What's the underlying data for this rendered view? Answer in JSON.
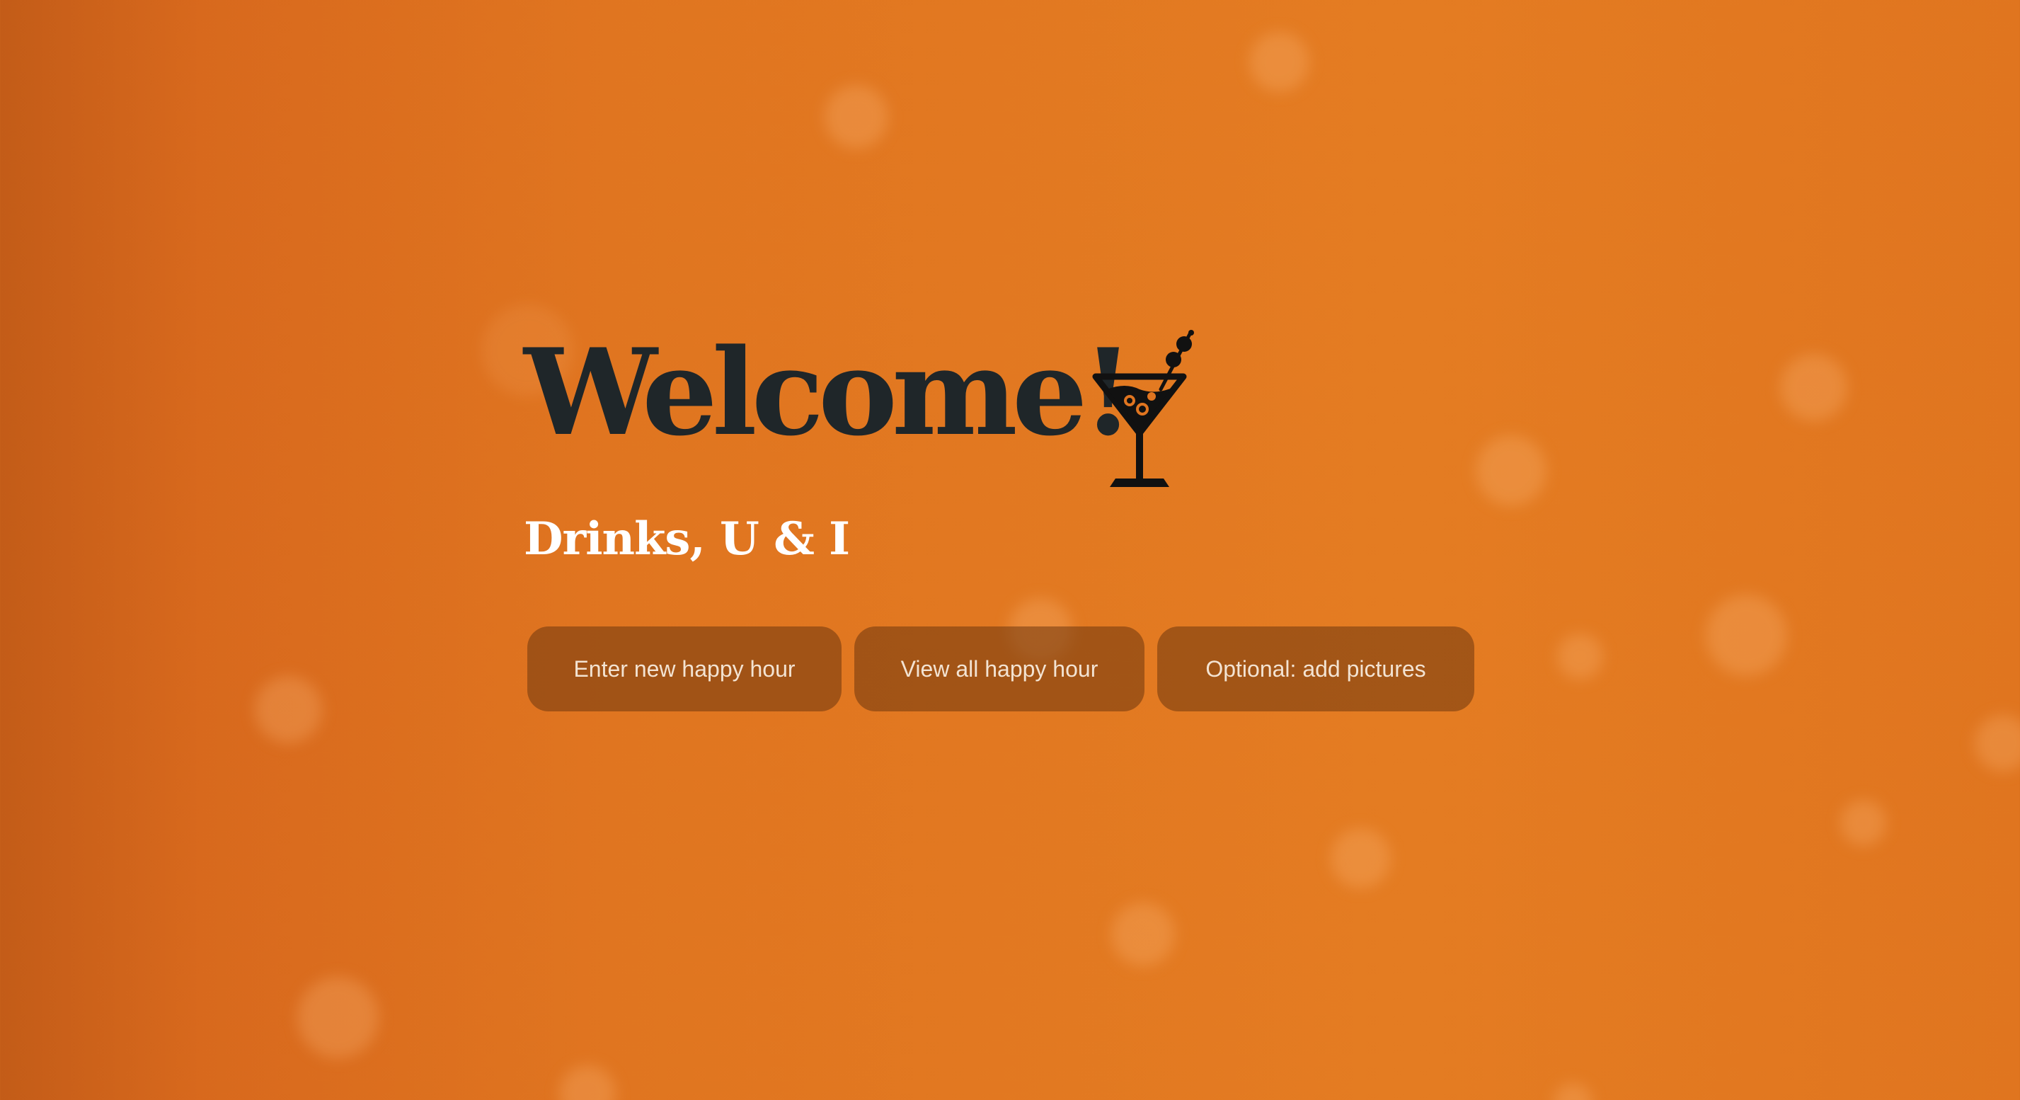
{
  "hero": {
    "title": "Welcome!",
    "subtitle": "Drinks, U & I"
  },
  "actions": {
    "enter_new": "Enter new happy hour",
    "view_all": "View all happy hour",
    "add_pictures": "Optional: add pictures"
  },
  "icons": {
    "hero_icon": "martini-glass-icon"
  },
  "colors": {
    "background": "#e07520",
    "title": "#1f2629",
    "subtitle": "#ffffff",
    "button_bg": "#8f4a16",
    "button_text": "#f3e3d2"
  }
}
